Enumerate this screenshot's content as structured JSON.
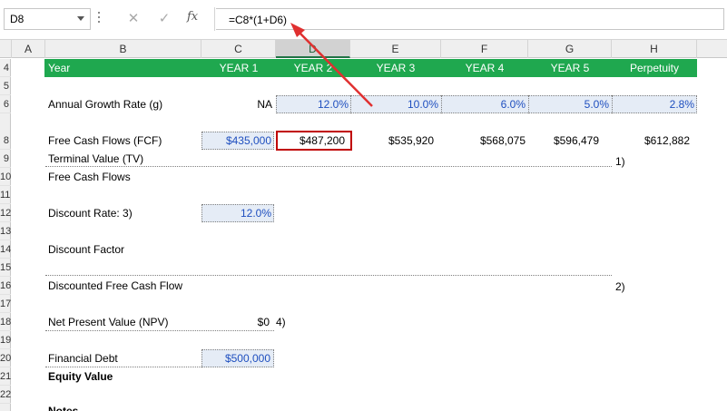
{
  "name_box": "D8",
  "formula": "=C8*(1+D6)",
  "toolbar": {
    "cancel_icon": "✕",
    "enter_icon": "✓",
    "fx_label": "fx"
  },
  "columns": [
    "A",
    "B",
    "C",
    "D",
    "E",
    "F",
    "G",
    "H"
  ],
  "rows": [
    "4",
    "5",
    "6",
    "8",
    "9",
    "10",
    "11",
    "12",
    "13",
    "14",
    "15",
    "16",
    "17",
    "18",
    "19",
    "20",
    "21",
    "22"
  ],
  "header_row": {
    "label": "Year",
    "years": [
      "YEAR 1",
      "YEAR 2",
      "YEAR 3",
      "YEAR 4",
      "YEAR 5",
      "Perpetuity"
    ]
  },
  "growth": {
    "label": "Annual Growth Rate (g)",
    "year1": "NA",
    "values": [
      "12.0%",
      "10.0%",
      "6.0%",
      "5.0%",
      "2.8%"
    ]
  },
  "fcf": {
    "label": "Free Cash Flows (FCF)",
    "values": [
      "$435,000",
      "$487,200",
      "$535,920",
      "$568,075",
      "$596,479",
      "$612,882"
    ]
  },
  "terminal": {
    "label": "Terminal Value (TV)",
    "note": "1)"
  },
  "free_cash_flows_label": "Free Cash Flows",
  "discount_rate": {
    "label": "Discount Rate: 3)",
    "value": "12.0%"
  },
  "discount_factor_label": "Discount Factor",
  "discounted_fcf": {
    "label": "Discounted Free Cash Flow",
    "note": "2)"
  },
  "npv": {
    "label": "Net Present Value (NPV)",
    "value": "$0",
    "note": "4)"
  },
  "debt": {
    "label": "Financial Debt",
    "value": "$500,000"
  },
  "equity_label": "Equity Value",
  "notes_label": "Notes",
  "colors": {
    "accent_green": "#1fa84f",
    "input_fill": "#e5ecf6",
    "selected_border": "#c00000",
    "input_text_blue": "#1f4fbf"
  }
}
